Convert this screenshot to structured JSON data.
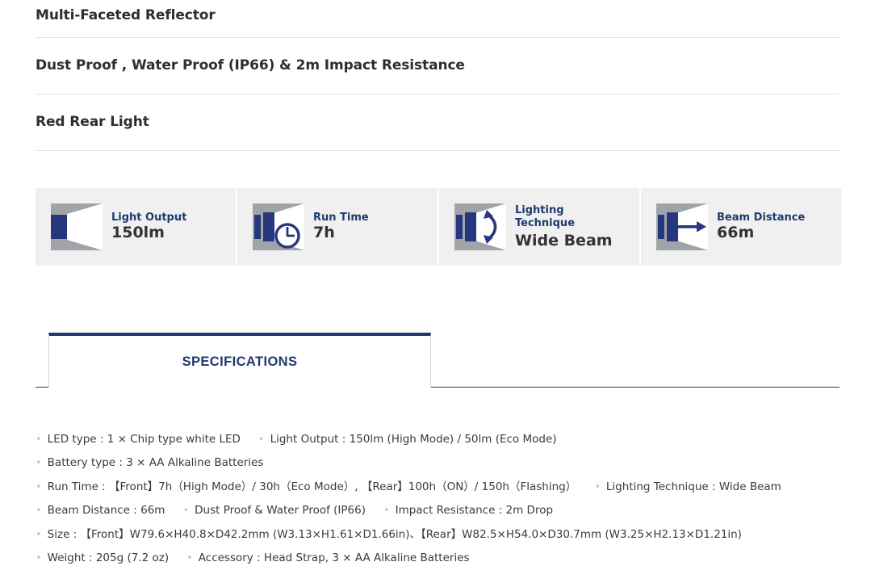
{
  "headlines": [
    {
      "text": "Multi-Faceted Reflector"
    },
    {
      "text": "Dust Proof , Water Proof (IP66) & 2m Impact Resistance"
    },
    {
      "text": "Red Rear Light"
    }
  ],
  "cards": [
    {
      "icon": "beam-light-output-icon",
      "label": "Light Output",
      "value": "150lm"
    },
    {
      "icon": "beam-run-time-clock-icon",
      "label": "Run Time",
      "value": "7h"
    },
    {
      "icon": "beam-lighting-technique-icon",
      "label": "Lighting\nTechnique",
      "value": "Wide Beam"
    },
    {
      "icon": "beam-distance-arrow-icon",
      "label": "Beam Distance",
      "value": "66m"
    }
  ],
  "tab": {
    "label": "SPECIFICATIONS"
  },
  "specs": [
    [
      "LED type : 1 × Chip type white LED",
      "Light Output : 150lm (High Mode) / 50lm (Eco Mode)"
    ],
    [
      "Battery type : 3 × AA Alkaline Batteries"
    ],
    [
      "Run Time :  【Front】7h（High Mode）/ 30h（Eco Mode）,  【Rear】100h（ON）/ 150h（Flashing）",
      "Lighting Technique : Wide Beam"
    ],
    [
      "Beam Distance : 66m",
      "Dust Proof & Water Proof (IP66)",
      "Impact Resistance : 2m Drop"
    ],
    [
      "Size :  【Front】W79.6×H40.8×D42.2mm (W3.13×H1.61×D1.66in)、【Rear】W82.5×H54.0×D30.7mm (W3.25×H2.13×D1.21in)"
    ],
    [
      "Weight : 205g (7.2 oz)",
      "Accessory : Head Strap, 3 × AA Alkaline Batteries"
    ]
  ],
  "colors": {
    "accent_navy": "#21386f",
    "card_background": "#f0f0f0",
    "icon_gray": "#a0a3a8",
    "icon_blue": "#26377d",
    "text_dark": "#333333",
    "bullet_gray": "#c8c8c8"
  },
  "bullet_glyph": "•"
}
